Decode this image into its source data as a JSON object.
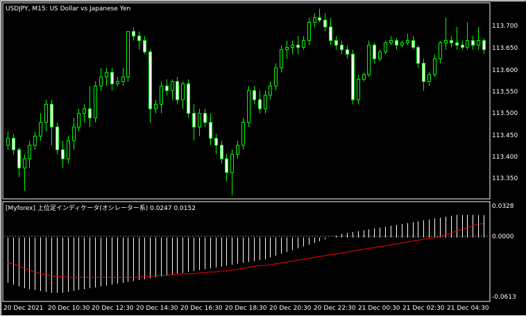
{
  "main_panel": {
    "title": "USDJPY, M15:  US Dollar vs Japanese Yen",
    "y_ticks": [
      "113.700",
      "113.650",
      "113.600",
      "113.550",
      "113.500",
      "113.450",
      "113.400",
      "113.350"
    ]
  },
  "indicator_panel": {
    "title": "[Myforex] 上位足インディケータ(オシレーター系) 0.0247 0.0152",
    "y_ticks": [
      "0.0328",
      "0.0000",
      "-0.0613"
    ]
  },
  "x_ticks": [
    "20 Dec 2021",
    "20 Dec 10:30",
    "20 Dec 12:30",
    "20 Dec 14:30",
    "20 Dec 16:30",
    "20 Dec 18:30",
    "20 Dec 20:30",
    "20 Dec 22:30",
    "21 Dec 00:30",
    "21 Dec 02:30",
    "21 Dec 04:30"
  ],
  "colors": {
    "background": "#000000",
    "up_candle": "#000000",
    "down_candle": "#ffffff",
    "wick": "#00ff00",
    "histogram": "#ffffff",
    "signal_line": "#ff0000",
    "frame": "#ffffff"
  },
  "chart_data": [
    {
      "type": "candlestick",
      "title": "USDJPY, M15:  US Dollar vs Japanese Yen",
      "ylim": [
        113.315,
        113.74
      ],
      "ohlc": [
        [
          113.43,
          113.46,
          113.42,
          113.445
        ],
        [
          113.445,
          113.455,
          113.41,
          113.42
        ],
        [
          113.42,
          113.425,
          113.36,
          113.38
        ],
        [
          113.38,
          113.41,
          113.33,
          113.4
        ],
        [
          113.4,
          113.44,
          113.38,
          113.43
        ],
        [
          113.43,
          113.46,
          113.42,
          113.45
        ],
        [
          113.45,
          113.5,
          113.44,
          113.48
        ],
        [
          113.48,
          113.53,
          113.46,
          113.52
        ],
        [
          113.52,
          113.53,
          113.43,
          113.47
        ],
        [
          113.47,
          113.48,
          113.41,
          113.42
        ],
        [
          113.42,
          113.44,
          113.38,
          113.4
        ],
        [
          113.4,
          113.45,
          113.39,
          113.44
        ],
        [
          113.44,
          113.49,
          113.42,
          113.47
        ],
        [
          113.47,
          113.51,
          113.46,
          113.5
        ],
        [
          113.5,
          113.52,
          113.48,
          113.51
        ],
        [
          113.51,
          113.56,
          113.47,
          113.49
        ],
        [
          113.49,
          113.57,
          113.48,
          113.56
        ],
        [
          113.56,
          113.6,
          113.55,
          113.58
        ],
        [
          113.58,
          113.6,
          113.56,
          113.59
        ],
        [
          113.59,
          113.6,
          113.55,
          113.565
        ],
        [
          113.565,
          113.58,
          113.56,
          113.57
        ],
        [
          113.57,
          113.6,
          113.56,
          113.58
        ],
        [
          113.58,
          113.65,
          113.57,
          113.68
        ],
        [
          113.68,
          113.69,
          113.66,
          113.67
        ],
        [
          113.67,
          113.68,
          113.64,
          113.66
        ],
        [
          113.66,
          113.67,
          113.63,
          113.635
        ],
        [
          113.635,
          113.64,
          113.48,
          113.51
        ],
        [
          113.51,
          113.53,
          113.5,
          113.52
        ],
        [
          113.52,
          113.57,
          113.5,
          113.56
        ],
        [
          113.56,
          113.575,
          113.54,
          113.55
        ],
        [
          113.55,
          113.575,
          113.53,
          113.57
        ],
        [
          113.57,
          113.58,
          113.52,
          113.53
        ],
        [
          113.53,
          113.57,
          113.51,
          113.565
        ],
        [
          113.565,
          113.575,
          113.49,
          113.5
        ],
        [
          113.5,
          113.52,
          113.44,
          113.47
        ],
        [
          113.47,
          113.51,
          113.45,
          113.5
        ],
        [
          113.5,
          113.51,
          113.47,
          113.48
        ],
        [
          113.48,
          113.5,
          113.43,
          113.445
        ],
        [
          113.445,
          113.455,
          113.41,
          113.43
        ],
        [
          113.43,
          113.44,
          113.39,
          113.4
        ],
        [
          113.4,
          113.41,
          113.35,
          113.37
        ],
        [
          113.37,
          113.42,
          113.32,
          113.41
        ],
        [
          113.41,
          113.44,
          113.4,
          113.43
        ],
        [
          113.43,
          113.49,
          113.42,
          113.48
        ],
        [
          113.48,
          113.56,
          113.47,
          113.55
        ],
        [
          113.55,
          113.56,
          113.52,
          113.53
        ],
        [
          113.53,
          113.55,
          113.5,
          113.51
        ],
        [
          113.51,
          113.55,
          113.5,
          113.54
        ],
        [
          113.54,
          113.57,
          113.53,
          113.56
        ],
        [
          113.56,
          113.61,
          113.55,
          113.6
        ],
        [
          113.6,
          113.65,
          113.59,
          113.64
        ],
        [
          113.64,
          113.66,
          113.62,
          113.645
        ],
        [
          113.645,
          113.66,
          113.63,
          113.65
        ],
        [
          113.65,
          113.67,
          113.63,
          113.645
        ],
        [
          113.645,
          113.67,
          113.64,
          113.66
        ],
        [
          113.66,
          113.71,
          113.65,
          113.7
        ],
        [
          113.7,
          113.72,
          113.69,
          113.71
        ],
        [
          113.71,
          113.73,
          113.7,
          113.705
        ],
        [
          113.705,
          113.72,
          113.68,
          113.69
        ],
        [
          113.69,
          113.71,
          113.65,
          113.66
        ],
        [
          113.66,
          113.67,
          113.64,
          113.65
        ],
        [
          113.65,
          113.66,
          113.63,
          113.64
        ],
        [
          113.64,
          113.65,
          113.62,
          113.63
        ],
        [
          113.63,
          113.64,
          113.52,
          113.53
        ],
        [
          113.53,
          113.585,
          113.52,
          113.575
        ],
        [
          113.575,
          113.59,
          113.57,
          113.585
        ],
        [
          113.585,
          113.66,
          113.58,
          113.65
        ],
        [
          113.65,
          113.655,
          113.61,
          113.62
        ],
        [
          113.62,
          113.64,
          113.615,
          113.635
        ],
        [
          113.635,
          113.66,
          113.63,
          113.655
        ],
        [
          113.655,
          113.67,
          113.65,
          113.66
        ],
        [
          113.66,
          113.665,
          113.64,
          113.65
        ],
        [
          113.65,
          113.66,
          113.645,
          113.655
        ],
        [
          113.655,
          113.675,
          113.65,
          113.66
        ],
        [
          113.66,
          113.67,
          113.64,
          113.645
        ],
        [
          113.645,
          113.65,
          113.6,
          113.61
        ],
        [
          113.61,
          113.62,
          113.55,
          113.57
        ],
        [
          113.57,
          113.59,
          113.56,
          113.585
        ],
        [
          113.585,
          113.63,
          113.58,
          113.62
        ],
        [
          113.62,
          113.66,
          113.61,
          113.655
        ],
        [
          113.655,
          113.71,
          113.64,
          113.66
        ],
        [
          113.66,
          113.67,
          113.645,
          113.655
        ],
        [
          113.655,
          113.69,
          113.64,
          113.65
        ],
        [
          113.65,
          113.66,
          113.64,
          113.645
        ],
        [
          113.645,
          113.7,
          113.64,
          113.66
        ],
        [
          113.66,
          113.67,
          113.64,
          113.65
        ],
        [
          113.65,
          113.69,
          113.64,
          113.66
        ],
        [
          113.66,
          113.665,
          113.63,
          113.64
        ]
      ]
    },
    {
      "type": "bar",
      "title": "[Myforex] 上位足インディケータ(オシレーター系) 0.0247 0.0152",
      "ylim": [
        -0.066,
        0.035
      ],
      "histogram": [
        -0.05,
        -0.052,
        -0.054,
        -0.056,
        -0.057,
        -0.058,
        -0.059,
        -0.06,
        -0.061,
        -0.061,
        -0.061,
        -0.06,
        -0.059,
        -0.058,
        -0.057,
        -0.056,
        -0.055,
        -0.054,
        -0.053,
        -0.052,
        -0.051,
        -0.05,
        -0.049,
        -0.048,
        -0.047,
        -0.046,
        -0.045,
        -0.044,
        -0.043,
        -0.042,
        -0.041,
        -0.04,
        -0.039,
        -0.038,
        -0.037,
        -0.036,
        -0.035,
        -0.034,
        -0.033,
        -0.032,
        -0.031,
        -0.03,
        -0.029,
        -0.028,
        -0.027,
        -0.026,
        -0.025,
        -0.024,
        -0.022,
        -0.02,
        -0.018,
        -0.016,
        -0.014,
        -0.012,
        -0.01,
        -0.008,
        -0.006,
        -0.004,
        -0.002,
        0.0,
        0.002,
        0.004,
        0.005,
        0.006,
        0.007,
        0.008,
        0.009,
        0.01,
        0.011,
        0.012,
        0.013,
        0.014,
        0.015,
        0.016,
        0.017,
        0.018,
        0.019,
        0.02,
        0.021,
        0.022,
        0.023,
        0.024,
        0.025,
        0.025,
        0.025,
        0.025,
        0.0247,
        0.0247
      ],
      "signal": [
        -0.028,
        -0.029,
        -0.031,
        -0.034,
        -0.036,
        -0.038,
        -0.04,
        -0.041,
        -0.042,
        -0.043,
        -0.043,
        -0.044,
        -0.044,
        -0.044,
        -0.044,
        -0.044,
        -0.044,
        -0.044,
        -0.044,
        -0.044,
        -0.044,
        -0.044,
        -0.044,
        -0.044,
        -0.044,
        -0.043,
        -0.043,
        -0.042,
        -0.042,
        -0.042,
        -0.041,
        -0.041,
        -0.04,
        -0.04,
        -0.04,
        -0.039,
        -0.039,
        -0.038,
        -0.038,
        -0.037,
        -0.037,
        -0.036,
        -0.035,
        -0.034,
        -0.033,
        -0.032,
        -0.031,
        -0.031,
        -0.03,
        -0.029,
        -0.028,
        -0.027,
        -0.026,
        -0.025,
        -0.024,
        -0.023,
        -0.022,
        -0.021,
        -0.02,
        -0.019,
        -0.018,
        -0.017,
        -0.016,
        -0.015,
        -0.014,
        -0.013,
        -0.012,
        -0.011,
        -0.01,
        -0.009,
        -0.008,
        -0.007,
        -0.006,
        -0.005,
        -0.004,
        -0.003,
        -0.002,
        -0.001,
        0.0,
        0.001,
        0.003,
        0.005,
        0.007,
        0.009,
        0.011,
        0.013,
        0.0152,
        0.0152
      ]
    }
  ]
}
